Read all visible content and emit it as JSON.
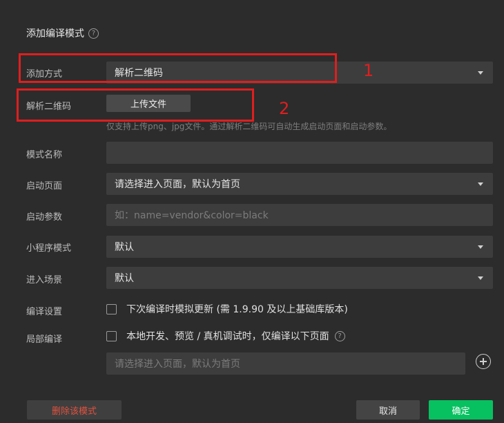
{
  "dialog": {
    "title": "添加编译模式",
    "help_icon": "question-circle-icon"
  },
  "form": {
    "add_method": {
      "label": "添加方式",
      "value": "解析二维码"
    },
    "parse_qr": {
      "label": "解析二维码",
      "button": "上传文件",
      "hint": "仅支持上传png、jpg文件。通过解析二维码可自动生成启动页面和启动参数。"
    },
    "mode_name": {
      "label": "模式名称",
      "value": ""
    },
    "start_page": {
      "label": "启动页面",
      "placeholder": "请选择进入页面，默认为首页"
    },
    "start_params": {
      "label": "启动参数",
      "placeholder": "如：name=vendor&color=black"
    },
    "mini_mode": {
      "label": "小程序模式",
      "value": "默认"
    },
    "scene": {
      "label": "进入场景",
      "value": "默认"
    },
    "compile_settings": {
      "label": "编译设置",
      "option": "下次编译时模拟更新 (需 1.9.90 及以上基础库版本)"
    },
    "partial_compile": {
      "label": "局部编译",
      "option": "本地开发、预览 / 真机调试时，仅编译以下页面",
      "placeholder": "请选择进入页面，默认为首页"
    }
  },
  "footer": {
    "delete": "删除该模式",
    "cancel": "取消",
    "confirm": "确定"
  },
  "annotations": [
    {
      "number": "1",
      "color": "#e01e1e"
    },
    {
      "number": "2",
      "color": "#e01e1e"
    }
  ],
  "colors": {
    "accent": "#07c160",
    "danger": "#e0523f",
    "annotation": "#e01e1e"
  }
}
